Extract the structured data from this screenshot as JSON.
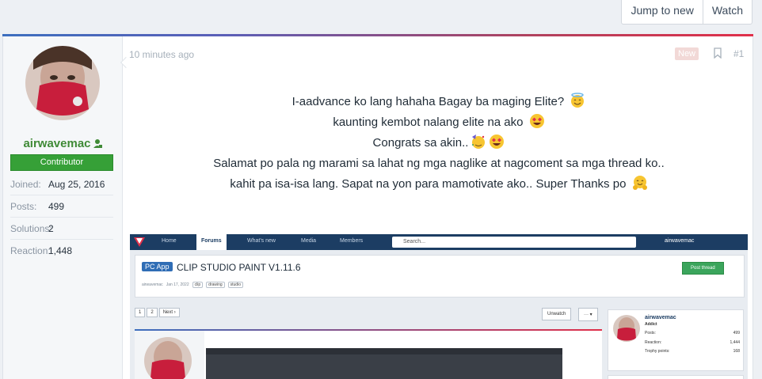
{
  "top_actions": {
    "jump_to_new": "Jump to new",
    "watch": "Watch"
  },
  "author": {
    "username": "airwavemac",
    "role": "Contributor",
    "stats": [
      {
        "label": "Joined:",
        "value": "Aug 25, 2016"
      },
      {
        "label": "Posts:",
        "value": "499"
      },
      {
        "label": "Solutions:",
        "value": "2"
      },
      {
        "label": "Reaction:",
        "value": "1,448"
      }
    ]
  },
  "post": {
    "time": "10 minutes ago",
    "badge": "New",
    "number": "#1",
    "lines": [
      "I-aadvance ko lang hahaha Bagay ba maging Elite?",
      "kaunting kembot nalang elite na ako",
      "Congrats sa akin..",
      "Salamat po pala ng marami sa lahat ng mga naglike at nagcoment sa mga thread ko..",
      "kahit pa isa-isa lang. Sapat na yon para mamotivate ako.. Super Thanks po"
    ],
    "emojis": [
      "smiling-halo-emoji",
      "heart-eyes-emoji",
      "party-face-emoji",
      "heart-eyes-emoji",
      "hugging-face-emoji"
    ]
  },
  "embedded_screenshot": {
    "nav_tabs": [
      "Home",
      "Forums",
      "What's new",
      "Media",
      "Members"
    ],
    "search_placeholder": "Search...",
    "nav_user": "airwavemac",
    "thread_prefix": "PC App",
    "thread_title": "CLIP STUDIO PAINT V1.11.6",
    "thread_author": "airwavemac",
    "thread_date": "Jan 17, 2022",
    "tags": [
      "clip",
      "drawing",
      "studio"
    ],
    "post_thread_btn": "Post thread",
    "pages": [
      "1",
      "2",
      "Next ›"
    ],
    "unwatch": "Unwatch",
    "more": "··· ▾",
    "card": {
      "name": "airwavemac",
      "role": "Addict",
      "rows": [
        {
          "label": "Posts:",
          "value": "499"
        },
        {
          "label": "Reaction:",
          "value": "1,444"
        },
        {
          "label": "Trophy points:",
          "value": "168"
        }
      ]
    }
  },
  "colors": {
    "accent_green": "#36a037",
    "username_green": "#3f8a36",
    "nav_blue": "#1c3d63"
  }
}
